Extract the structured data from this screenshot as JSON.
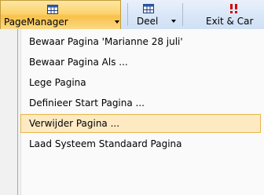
{
  "ribbon": {
    "buttons": [
      {
        "label": "PageManager",
        "icon": "table-icon"
      },
      {
        "label": "Deel",
        "icon": "table-icon"
      },
      {
        "label": "Exit & Car",
        "icon": "exclamation-icon"
      }
    ]
  },
  "menu": {
    "items": [
      {
        "label": "Bewaar Pagina 'Marianne 28 juli'"
      },
      {
        "label": "Bewaar Pagina Als ..."
      },
      {
        "label": "Lege Pagina"
      },
      {
        "label": "Definieer Start Pagina ..."
      },
      {
        "label": "Verwijder Pagina ...",
        "highlighted": true
      },
      {
        "label": "Laad Systeem Standaard Pagina"
      }
    ]
  },
  "colors": {
    "highlight_bg": "#fdeac3",
    "highlight_border": "#e5b64b",
    "active_button": "#f8c14a",
    "exit_icon": "#d80000"
  }
}
